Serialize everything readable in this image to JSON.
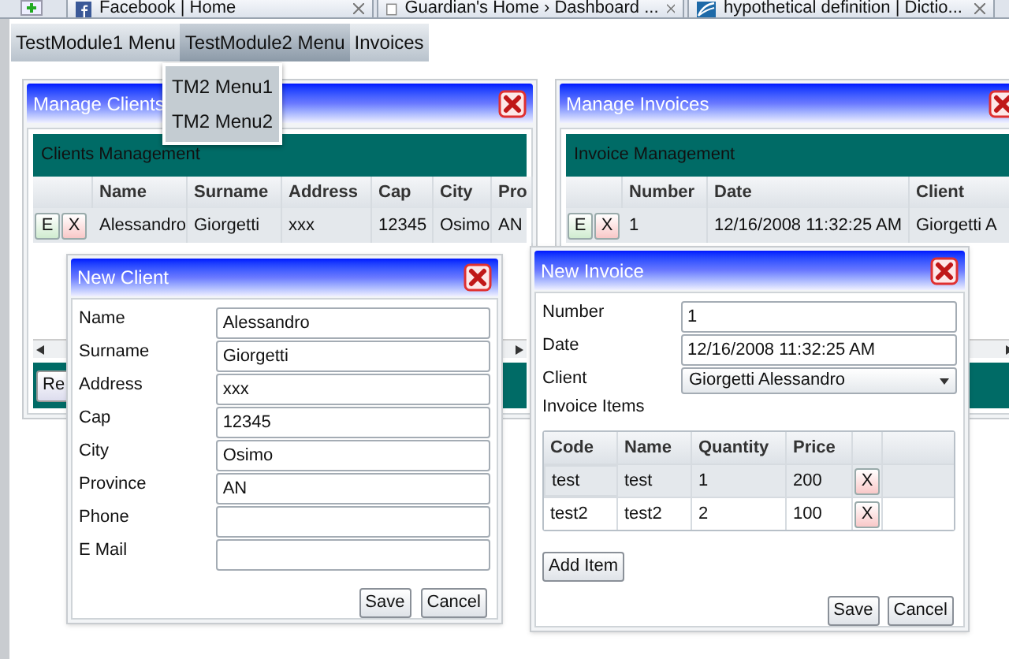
{
  "browser_tabs": [
    {
      "label": "Facebook | Home",
      "kind": "facebook"
    },
    {
      "label": "Guardian's Home › Dashboard ...",
      "kind": "page"
    },
    {
      "label": "hypothetical definition | Dictio...",
      "kind": "dictionary"
    }
  ],
  "menu": [
    {
      "label": "TestModule1 Menu",
      "selected": false
    },
    {
      "label": "TestModule2 Menu",
      "selected": true
    },
    {
      "label": "Invoices",
      "selected": false
    }
  ],
  "dropdown": [
    "TM2 Menu1",
    "TM2 Menu2"
  ],
  "clients_panel": {
    "title": "Manage Clients",
    "header": "Clients Management",
    "columns": [
      "Name",
      "Surname",
      "Address",
      "Cap",
      "City",
      "Pro"
    ],
    "rows": [
      {
        "edit": "E",
        "delete": "X",
        "cells": [
          "Alessandro",
          "Giorgetti",
          "xxx",
          "12345",
          "Osimo",
          "AN"
        ]
      }
    ],
    "footer_button": "Re"
  },
  "invoices_panel": {
    "title": "Manage Invoices",
    "header": "Invoice Management",
    "columns": [
      "Number",
      "Date",
      "Client"
    ],
    "rows": [
      {
        "edit": "E",
        "delete": "X",
        "cells": [
          "1",
          "12/16/2008 11:32:25 AM",
          "Giorgetti A"
        ]
      }
    ]
  },
  "client_dialog": {
    "title": "New Client",
    "fields": [
      {
        "label": "Name",
        "value": "Alessandro"
      },
      {
        "label": "Surname",
        "value": "Giorgetti"
      },
      {
        "label": "Address",
        "value": "xxx"
      },
      {
        "label": "Cap",
        "value": "12345"
      },
      {
        "label": "City",
        "value": "Osimo"
      },
      {
        "label": "Province",
        "value": "AN"
      },
      {
        "label": "Phone"
      },
      {
        "label": "E Mail"
      }
    ],
    "buttons": [
      "Save",
      "Cancel"
    ]
  },
  "invoice_dialog": {
    "title": "New Invoice",
    "fields": [
      {
        "label": "Number",
        "value": "1",
        "kind": "text"
      },
      {
        "label": "Date",
        "value": "12/16/2008 11:32:25 AM",
        "kind": "text"
      },
      {
        "label": "Client",
        "value": "Giorgetti Alessandro",
        "kind": "dropdown"
      }
    ],
    "items_label": "Invoice Items",
    "columns": [
      "Code",
      "Name",
      "Quantity",
      "Price"
    ],
    "items": [
      {
        "cells": [
          "test",
          "test",
          "1",
          "200"
        ],
        "delete": "X",
        "selected": true
      },
      {
        "cells": [
          "test2",
          "test2",
          "2",
          "100"
        ],
        "delete": "X",
        "selected": false
      }
    ],
    "add_button": "Add Item",
    "buttons": [
      "Save",
      "Cancel"
    ]
  }
}
